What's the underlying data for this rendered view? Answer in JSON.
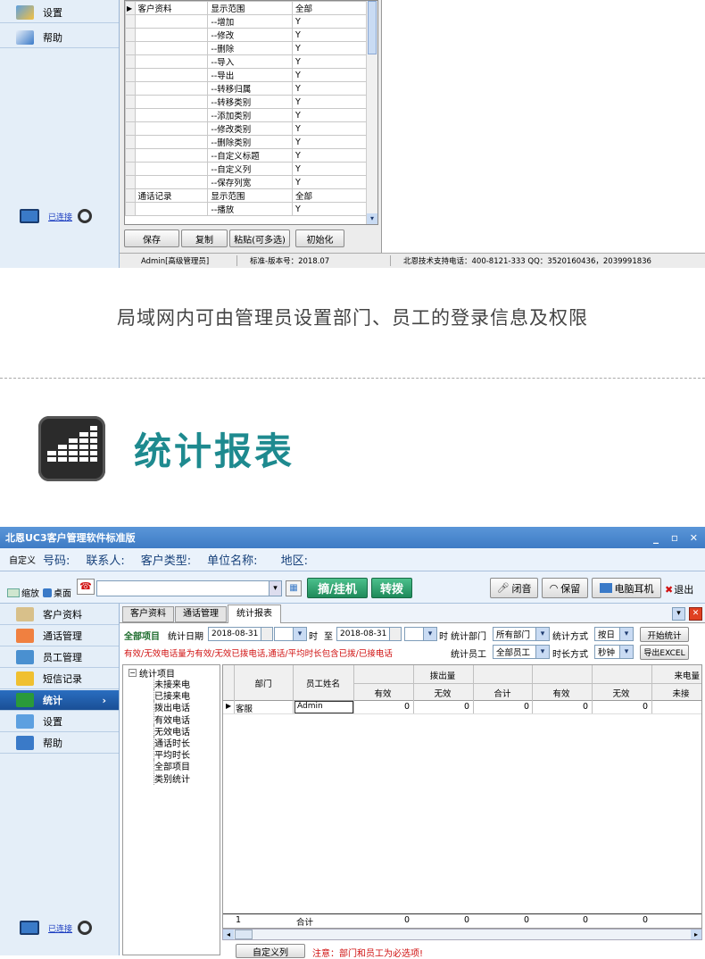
{
  "top": {
    "sidebar": [
      {
        "label": "设置",
        "icon": "wrench-icon"
      },
      {
        "label": "帮助",
        "icon": "help-icon"
      }
    ],
    "connection_status": "已连接",
    "grid_rows": [
      {
        "marker": "▶",
        "module": "客户资料",
        "perm": "显示范围",
        "value": "全部"
      },
      {
        "marker": "",
        "module": "",
        "perm": "--增加",
        "value": "Y"
      },
      {
        "marker": "",
        "module": "",
        "perm": "--修改",
        "value": "Y"
      },
      {
        "marker": "",
        "module": "",
        "perm": "--删除",
        "value": "Y"
      },
      {
        "marker": "",
        "module": "",
        "perm": "--导入",
        "value": "Y"
      },
      {
        "marker": "",
        "module": "",
        "perm": "--导出",
        "value": "Y"
      },
      {
        "marker": "",
        "module": "",
        "perm": "--转移归属",
        "value": "Y"
      },
      {
        "marker": "",
        "module": "",
        "perm": "--转移类别",
        "value": "Y"
      },
      {
        "marker": "",
        "module": "",
        "perm": "--添加类别",
        "value": "Y"
      },
      {
        "marker": "",
        "module": "",
        "perm": "--修改类别",
        "value": "Y"
      },
      {
        "marker": "",
        "module": "",
        "perm": "--删除类别",
        "value": "Y"
      },
      {
        "marker": "",
        "module": "",
        "perm": "--自定义标题",
        "value": "Y"
      },
      {
        "marker": "",
        "module": "",
        "perm": "--自定义列",
        "value": "Y"
      },
      {
        "marker": "",
        "module": "",
        "perm": "--保存列宽",
        "value": "Y"
      },
      {
        "marker": "",
        "module": "通话记录",
        "perm": "显示范围",
        "value": "全部"
      },
      {
        "marker": "",
        "module": "",
        "perm": "--播放",
        "value": "Y"
      }
    ],
    "buttons": [
      "保存",
      "复制",
      "粘贴(可多选)",
      "初始化"
    ],
    "status": {
      "user": "Admin[高级管理员]",
      "version": "标准-版本号：2018.07",
      "support": "北恩技术支持电话：400-8121-333  QQ：3520160436，2039991836"
    }
  },
  "caption": "局域网内可由管理员设置部门、员工的登录信息及权限",
  "section_title": "统计报表",
  "app": {
    "title": "北恩UC3客户管理软件标准版",
    "win_controls": [
      "_",
      "▫",
      "✕"
    ],
    "custom_label": "自定义",
    "fields": [
      "号码:",
      "联系人:",
      "客户类型:",
      "单位名称:",
      "地区:"
    ],
    "shrink": "缩放",
    "desktop": "桌面",
    "hangup_button": "摘/挂机",
    "transfer_button": "转拨",
    "mute_button": "闭音",
    "hold_button": "保留",
    "headset_button": "电脑耳机",
    "exit_button": "退出",
    "sidebar": [
      {
        "label": "客户资料",
        "icon": "contacts-icon"
      },
      {
        "label": "通话管理",
        "icon": "phone-icon"
      },
      {
        "label": "员工管理",
        "icon": "people-icon"
      },
      {
        "label": "短信记录",
        "icon": "envelope-icon"
      },
      {
        "label": "统计",
        "icon": "chart-icon"
      },
      {
        "label": "设置",
        "icon": "wrench-icon"
      },
      {
        "label": "帮助",
        "icon": "help-icon"
      }
    ],
    "connection_status": "已连接",
    "tabs": [
      "客户资料",
      "通话管理",
      "统计报表"
    ],
    "filters": {
      "all_items": "全部项目",
      "date_label": "统计日期",
      "date_from": "2018-08-31",
      "hour_label": "时",
      "to_label": "至",
      "date_to": "2018-08-31",
      "hour_label2": "时",
      "dept_label": "统计部门",
      "dept_value": "所有部门",
      "mode_label": "统计方式",
      "mode_value": "按日",
      "start_button": "开始统计",
      "note": "有效/无效电话量为有效/无效已拨电话,通话/平均时长包含已拨/已接电话",
      "staff_label": "统计员工",
      "staff_value": "全部员工",
      "duration_label": "时长方式",
      "duration_value": "秒钟",
      "export_button": "导出EXCEL"
    },
    "tree": {
      "root": "统计项目",
      "items": [
        "未接来电",
        "已接来电",
        "拨出电话",
        "有效电话",
        "无效电话",
        "通话时长",
        "平均时长",
        "全部项目",
        "类别统计"
      ]
    },
    "table": {
      "col_dept": "部门",
      "col_name": "员工姓名",
      "group_out": "拨出量",
      "group_in": "来电量",
      "sub_out": [
        "有效",
        "无效",
        "合计"
      ],
      "sub_in": [
        "有效",
        "无效",
        "未接"
      ],
      "row": {
        "marker": "▶",
        "dept": "客服",
        "name": "Admin",
        "values": [
          "0",
          "0",
          "0",
          "0",
          "0",
          ""
        ]
      },
      "footer": {
        "dept": "1",
        "name": "合计",
        "values": [
          "0",
          "0",
          "0",
          "0",
          "0",
          ""
        ]
      }
    },
    "custom_column_button": "自定义列",
    "warning": "注意：部门和员工为必选项!"
  },
  "colors": {
    "accent": "#1e8a8f",
    "title_bar": "#4a88cf",
    "red": "#d01010"
  }
}
